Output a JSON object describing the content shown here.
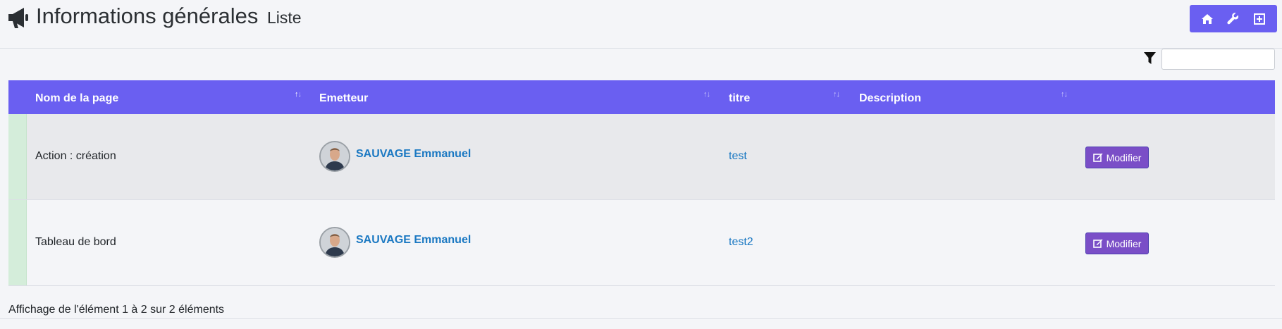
{
  "header": {
    "icon": "megaphone-icon",
    "title": "Informations générales",
    "subtitle": "Liste"
  },
  "toolbar": {
    "buttons": [
      {
        "icon": "home-icon"
      },
      {
        "icon": "wrench-icon"
      },
      {
        "icon": "plus-square-icon"
      }
    ],
    "color": "#6a5ff1"
  },
  "filter": {
    "icon": "filter-icon",
    "value": ""
  },
  "table": {
    "header_color": "#6a5ff1",
    "columns": [
      "Nom de la page",
      "Emetteur",
      "titre",
      "Description"
    ],
    "rows": [
      {
        "page": "Action : création",
        "author": "SAUVAGE Emmanuel",
        "titre": "test",
        "description": "",
        "action": "Modifier"
      },
      {
        "page": "Tableau de bord",
        "author": "SAUVAGE Emmanuel",
        "titre": "test2",
        "description": "",
        "action": "Modifier"
      }
    ]
  },
  "footer": {
    "info": "Affichage de l'élément 1 à 2 sur 2 éléments"
  }
}
